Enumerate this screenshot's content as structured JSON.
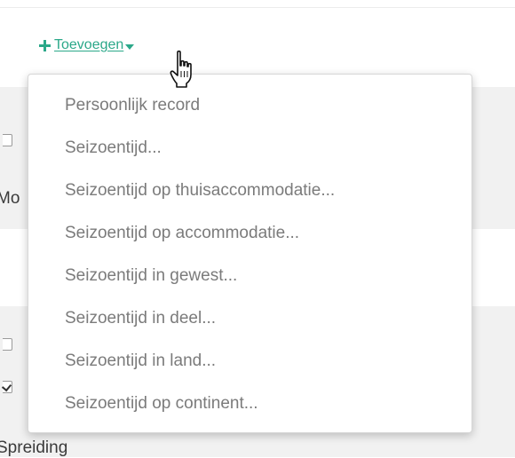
{
  "add_button": {
    "label": "Toevoegen",
    "accent_color": "#2ba889"
  },
  "dropdown": {
    "items": [
      "Persoonlijk record",
      "Seizoentijd...",
      "Seizoentijd op thuisaccommodatie...",
      "Seizoentijd op accommodatie...",
      "Seizoentijd in gewest...",
      "Seizoentijd in deel...",
      "Seizoentijd in land...",
      "Seizoentijd op continent..."
    ]
  },
  "background": {
    "label_1": "Mo",
    "label_2": "Spreiding"
  }
}
